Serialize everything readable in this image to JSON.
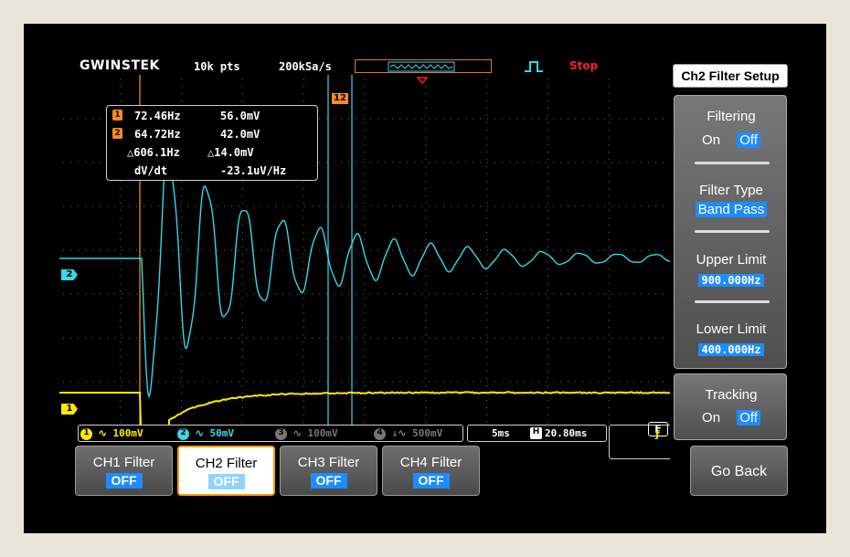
{
  "topbar": {
    "brand": "GWINSTEK",
    "record_length": "10k pts",
    "sample_rate": "200kSa/s",
    "run_status": "Stop"
  },
  "readout": {
    "cursor1_badge": "1",
    "cursor2_badge": "2",
    "row1": {
      "freq": "72.46Hz",
      "volt": "56.0mV"
    },
    "row2": {
      "freq": "64.72Hz",
      "volt": "42.0mV"
    },
    "row3": {
      "freq": "△606.1Hz",
      "volt": "△14.0mV"
    },
    "row4": {
      "label": "dV/dt",
      "value": "-23.1uV/Hz"
    }
  },
  "markers": {
    "ch2": "2",
    "ch1": "1",
    "cursor_tag": "12",
    "filter_badge": "F"
  },
  "channel_bar": {
    "ch1": {
      "num": "1",
      "coupling": "∿",
      "scale": "100mV",
      "color": "#ffea00"
    },
    "ch2": {
      "num": "2",
      "coupling": "∿",
      "scale": "50mV",
      "color": "#39d6e6"
    },
    "ch3": {
      "num": "3",
      "coupling": "∿",
      "scale": "100mV",
      "color": "#777777"
    },
    "ch4": {
      "num": "4",
      "coupling": "↓∿",
      "scale": "500mV",
      "color": "#777777"
    }
  },
  "timebase": {
    "scale": "5ms",
    "h_icon": "H",
    "position": "20.80ms"
  },
  "trigger": {
    "source": "1",
    "slope": "ƒ"
  },
  "softkeys": [
    {
      "label": "CH1 Filter",
      "value": "OFF"
    },
    {
      "label": "CH2 Filter",
      "value": "OFF"
    },
    {
      "label": "CH3 Filter",
      "value": "OFF"
    },
    {
      "label": "CH4 Filter",
      "value": "OFF"
    }
  ],
  "menu": {
    "title": "Ch2 Filter Setup",
    "filtering": {
      "label": "Filtering",
      "on": "On",
      "off": "Off"
    },
    "filter_type": {
      "label": "Filter Type",
      "value": "Band Pass"
    },
    "upper_limit": {
      "label": "Upper Limit",
      "value": "900.000Hz"
    },
    "lower_limit": {
      "label": "Lower Limit",
      "value": "400.000Hz"
    },
    "tracking": {
      "label": "Tracking",
      "on": "On",
      "off": "Off"
    },
    "go_back": "Go Back"
  },
  "colors": {
    "ch1": "#ffea00",
    "ch2": "#39d6e6",
    "cursor": "#ff8a1e",
    "highlight": "#1e8bff"
  }
}
